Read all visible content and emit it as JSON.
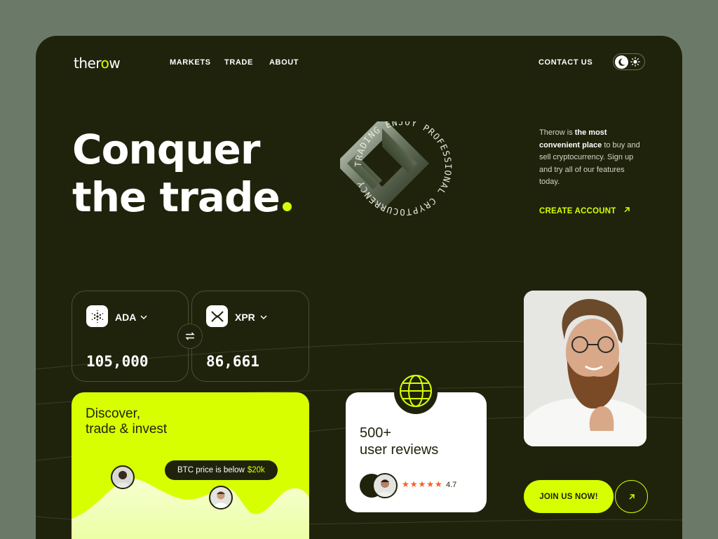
{
  "brand": {
    "logo_prefix": "ther",
    "logo_o": "o",
    "logo_suffix": "w"
  },
  "nav": {
    "markets": "MARKETS",
    "trade": "TRADE",
    "about": "ABOUT",
    "contact": "CONTACT US"
  },
  "hero": {
    "line1": "Conquer",
    "line2": "the trade",
    "rotating_text": "TRADING ENJOY PROFESSIONAL CRYPTOCURRENCY",
    "desc_brand": "Therow",
    "desc_is": " is ",
    "desc_bold": "the most convenient place",
    "desc_rest": " to buy and sell cryptocurrency. Sign up and try all of our features today.",
    "cta": "CREATE ACCOUNT"
  },
  "exchange": {
    "from": {
      "name": "ADA",
      "amount": "105,000"
    },
    "to": {
      "name": "XPR",
      "amount": "86,661"
    }
  },
  "discover": {
    "line1": "Discover,",
    "line2": "trade & invest",
    "tooltip_text": "BTC price is below",
    "tooltip_value": "$20k"
  },
  "reviews": {
    "count": "500+",
    "label": "user reviews",
    "stars": "★★★★★",
    "rating": "4.7"
  },
  "join": {
    "label": "JOIN US NOW!"
  },
  "colors": {
    "accent": "#d8ff00",
    "background": "#1f230c",
    "outer": "#6b7a68",
    "star": "#ff5a1f"
  }
}
